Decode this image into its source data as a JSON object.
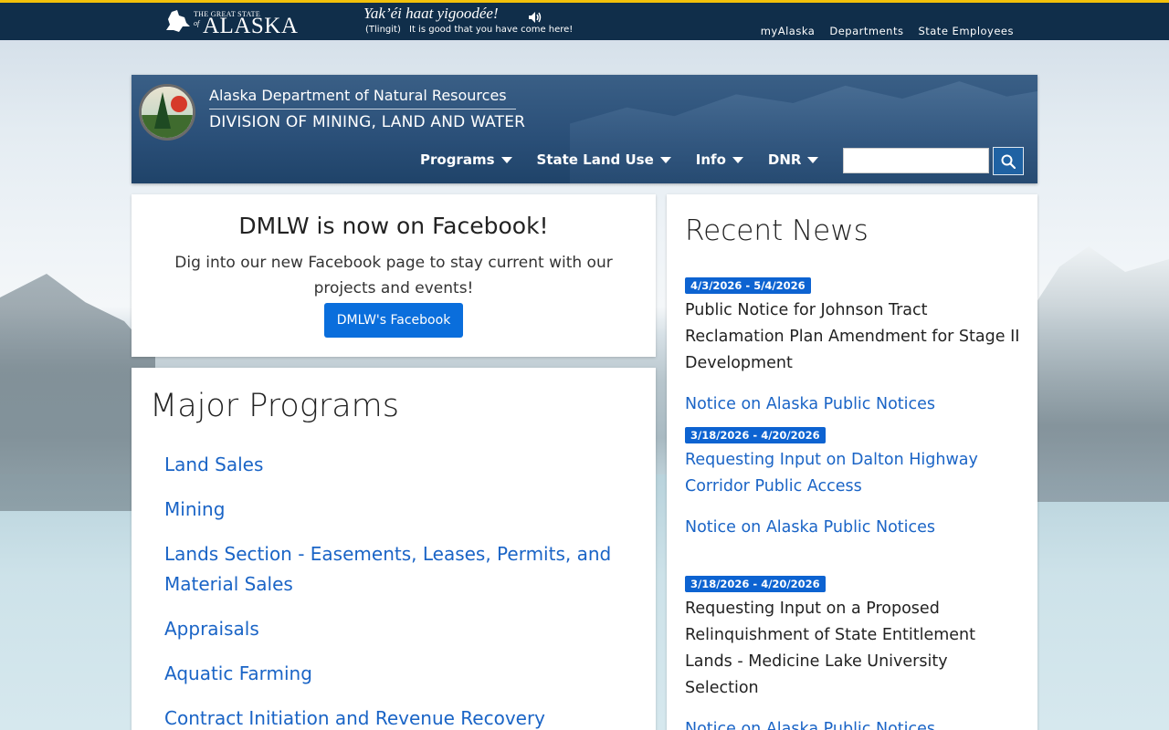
{
  "state_bar": {
    "logo_small": "THE GREAT STATE",
    "logo_of": "of",
    "logo_big": "ALASKA",
    "greeting": "Yak’éi haat yigoodée!",
    "language": "(Tlingit)",
    "translation": "It is good that you have come here!",
    "links": [
      "myAlaska",
      "Departments",
      "State Employees"
    ]
  },
  "header": {
    "department": "Alaska Department of Natural Resources",
    "division": "DIVISION OF MINING, LAND AND WATER",
    "nav": [
      {
        "label": "Programs"
      },
      {
        "label": "State Land Use"
      },
      {
        "label": "Info"
      },
      {
        "label": "DNR"
      }
    ],
    "search": {
      "value": "",
      "placeholder": ""
    }
  },
  "facebook": {
    "title": "DMLW is now on Facebook!",
    "text": "Dig into our new Facebook page to stay current with our projects and events!",
    "button": "DMLW's Facebook"
  },
  "programs": {
    "title": "Major Programs",
    "items": [
      "Land Sales",
      "Mining",
      "Lands Section - Easements, Leases, Permits, and Material Sales",
      "Appraisals",
      "Aquatic Farming",
      "Contract Initiation and Revenue Recovery"
    ]
  },
  "news": {
    "title": "Recent News",
    "items": [
      {
        "date": "4/3/2026 - 5/4/2026",
        "headline": "Public Notice for Johnson Tract Reclamation Plan Amendment for Stage II Development",
        "notice": "Notice on Alaska Public Notices"
      },
      {
        "date": "3/18/2026 - 4/20/2026",
        "headline": "Requesting Input on Dalton Highway Corridor Public Access",
        "notice": "Notice on Alaska Public Notices"
      },
      {
        "date": "3/18/2026 - 4/20/2026",
        "headline": "Requesting Input on a Proposed Relinquishment of State Entitlement Lands - Medicine Lake University Selection",
        "notice": "Notice on Alaska Public Notices"
      }
    ]
  }
}
